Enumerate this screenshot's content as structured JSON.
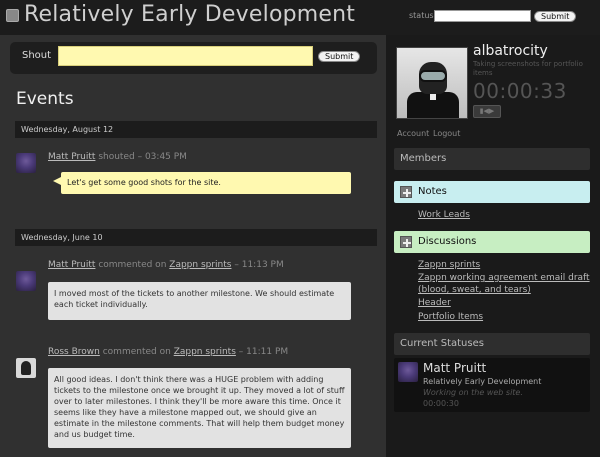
{
  "header": {
    "title": "Relatively Early Development",
    "status_label": "status:",
    "status_value": "",
    "status_submit": "Submit"
  },
  "shout": {
    "label": "Shout",
    "value": "",
    "submit": "Submit"
  },
  "events": {
    "heading": "Events",
    "groups": [
      {
        "date": "Wednesday, August 12",
        "items": [
          {
            "author": "Matt Pruitt",
            "action": "shouted",
            "time": "03:45 PM",
            "message": "Let's get some good shots for the site."
          }
        ]
      },
      {
        "date": "Wednesday, June 10",
        "items": [
          {
            "author": "Matt Pruitt",
            "action": "commented on",
            "target": "Zappn sprints",
            "time": "11:13 PM",
            "message": "I moved most of the tickets to another milestone. We should estimate each ticket individually."
          },
          {
            "author": "Ross Brown",
            "action": "commented on",
            "target": "Zappn sprints",
            "time": "11:11 PM",
            "message": "All good ideas. I don't think there was a HUGE problem with adding tickets to the milestone once we brought it up. They moved a lot of stuff over to later milestones. I think they'll be more aware this time. Once it seems like they have a milestone mapped out, we should give an estimate in the milestone comments. That will help them budget money and us budget time."
          }
        ]
      }
    ]
  },
  "profile": {
    "username": "albatrocity",
    "status": "Taking screenshots for portfolio items",
    "timer": "00:00:33",
    "account_link": "Account",
    "logout_link": "Logout"
  },
  "sidebar": {
    "members_heading": "Members",
    "notes_heading": "Notes",
    "notes_links": [
      "Work Leads"
    ],
    "discussions_heading": "Discussions",
    "discussion_links": [
      "Zappn sprints",
      "Zappn working agreement email draft",
      "(blood, sweat, and tears)",
      "Header",
      "Portfolio Items"
    ],
    "statuses_heading": "Current Statuses",
    "current_status": {
      "name": "Matt Pruitt",
      "project": "Relatively Early Development",
      "status": "Working on the web site.",
      "time": "00:00:30"
    }
  },
  "colors": {
    "shout_yellow": "#fff9b0",
    "notes_cyan": "#c8eef0",
    "discussions_green": "#c7eec2",
    "page_bg": "#303030",
    "sidebar_bg": "#1a1a1a"
  }
}
